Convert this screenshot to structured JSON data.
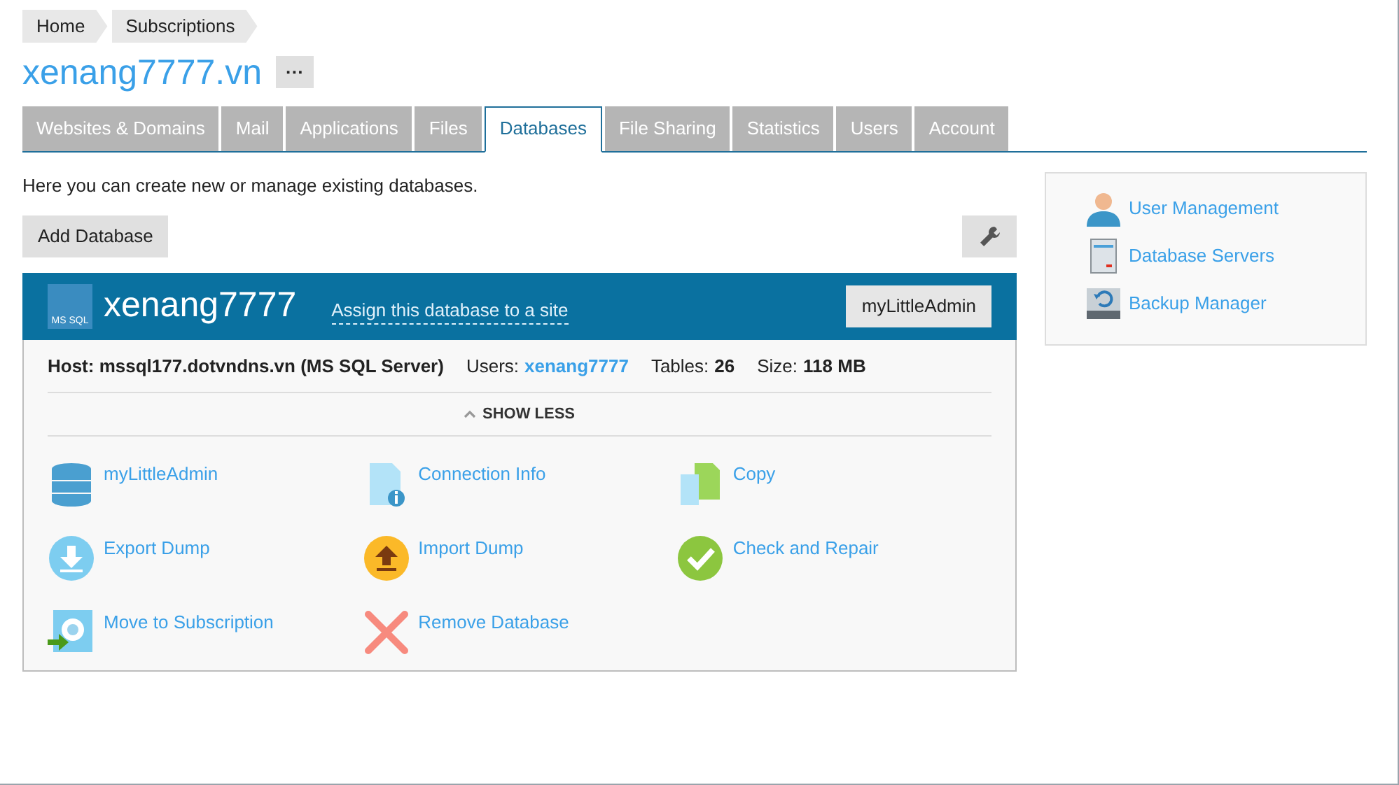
{
  "breadcrumbs": [
    "Home",
    "Subscriptions"
  ],
  "title": "xenang7777.vn",
  "more_button": "···",
  "tabs": [
    {
      "label": "Websites & Domains",
      "selected": false
    },
    {
      "label": "Mail",
      "selected": false
    },
    {
      "label": "Applications",
      "selected": false
    },
    {
      "label": "Files",
      "selected": false
    },
    {
      "label": "Databases",
      "selected": true
    },
    {
      "label": "File Sharing",
      "selected": false
    },
    {
      "label": "Statistics",
      "selected": false
    },
    {
      "label": "Users",
      "selected": false
    },
    {
      "label": "Account",
      "selected": false
    }
  ],
  "intro": "Here you can create new or manage existing databases.",
  "add_button": "Add Database",
  "database": {
    "logo_text": "MS SQL",
    "name": "xenang7777",
    "assign_link": "Assign this database to a site",
    "admin_button": "myLittleAdmin",
    "host": "Host: mssql177.dotvndns.vn (MS SQL Server)",
    "stats": [
      {
        "label": "Users:",
        "value": "xenang7777",
        "kind": "link"
      },
      {
        "label": "Tables:",
        "value": "26",
        "kind": "bold"
      },
      {
        "label": "Size:",
        "value": "118 MB",
        "kind": "bold"
      }
    ],
    "toggle": "SHOW LESS",
    "expanded": true,
    "actions": [
      {
        "label": "myLittleAdmin",
        "kind": "database"
      },
      {
        "label": "Connection Info",
        "kind": "info"
      },
      {
        "label": "Copy",
        "kind": "copy"
      },
      {
        "label": "Export Dump",
        "kind": "export"
      },
      {
        "label": "Import Dump",
        "kind": "import"
      },
      {
        "label": "Check and Repair",
        "kind": "check"
      },
      {
        "label": "Move to Subscription",
        "kind": "move"
      },
      {
        "label": "Remove Database",
        "kind": "remove"
      }
    ]
  },
  "sidebar": {
    "items": [
      {
        "label": "User Management",
        "kind": "user"
      },
      {
        "label": "Database Servers",
        "kind": "server"
      },
      {
        "label": "Backup Manager",
        "kind": "backup"
      }
    ]
  }
}
